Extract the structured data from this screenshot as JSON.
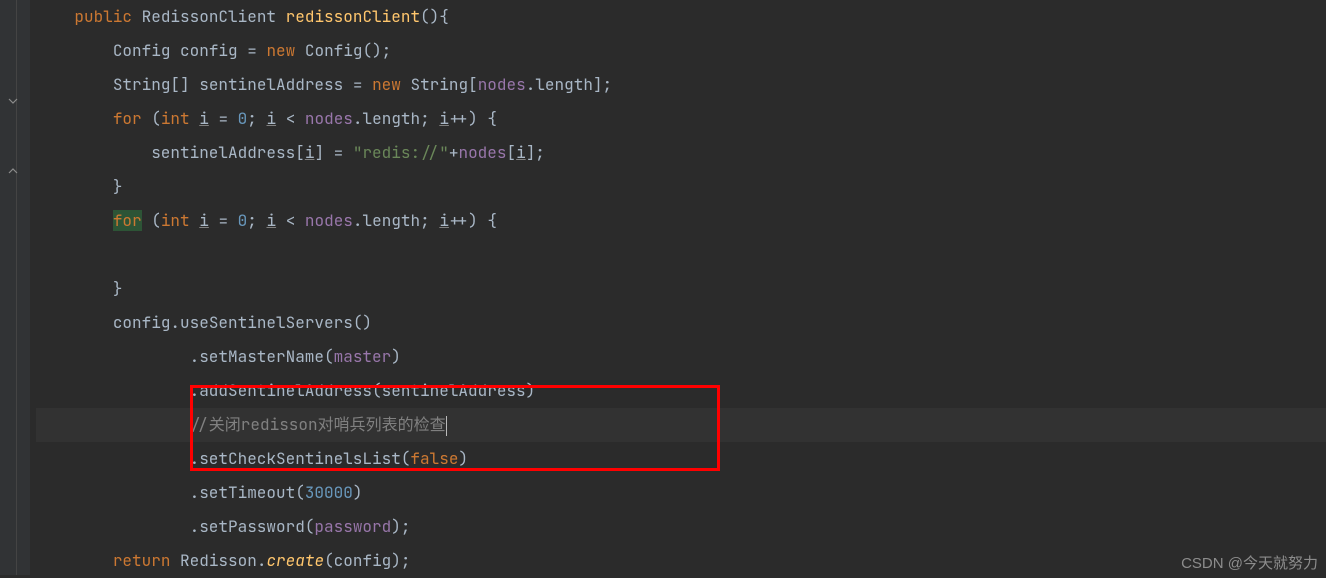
{
  "code": {
    "l1": {
      "kw": "public",
      "type": "RedissonClient",
      "method": "redissonClient",
      "after": "(){"
    },
    "l2": {
      "type": "Config",
      "var": "config",
      "eq": " = ",
      "new": "new",
      "cls": "Config",
      "end": "();"
    },
    "l3": {
      "type": "String[]",
      "var": "sentinelAddress",
      "eq": " = ",
      "new": "new",
      "cls": "String",
      "field": "nodes",
      "prop": ".length",
      "end": "];",
      "open": "["
    },
    "l4": {
      "kw": "for",
      "open": " (",
      "type": "int",
      "var": "i",
      "eq": " = ",
      "zero": "0",
      "sep": "; ",
      "var2": "i",
      "cmp": " < ",
      "field": "nodes",
      "prop": ".length",
      "sep2": "; ",
      "var3": "i",
      "inc": "++) {"
    },
    "l5": {
      "var": "sentinelAddress",
      "open": "[",
      "idx": "i",
      "close": "] = ",
      "str": "\"redis://\"",
      "plus": "+",
      "field": "nodes",
      "open2": "[",
      "idx2": "i",
      "end": "];"
    },
    "l6": {
      "close": "}"
    },
    "l7": {
      "kw": "for",
      "open": " (",
      "type": "int",
      "var": "i",
      "eq": " = ",
      "zero": "0",
      "sep": "; ",
      "var2": "i",
      "cmp": " < ",
      "field": "nodes",
      "prop": ".length",
      "sep2": "; ",
      "var3": "i",
      "inc": "++) {"
    },
    "l8": {
      "blank": ""
    },
    "l9": {
      "close": "}"
    },
    "l10": {
      "var": "config",
      "call": ".useSentinelServers()"
    },
    "l11": {
      "call": ".setMasterName(",
      "field": "master",
      "end": ")"
    },
    "l12": {
      "call": ".addSentinelAddress(",
      "arg": "sentinelAddress",
      "end": ")"
    },
    "l13": {
      "comment": "//关闭redisson对哨兵列表的检查"
    },
    "l14": {
      "call": ".setCheckSentinelsList(",
      "bool": "false",
      "end": ")"
    },
    "l15": {
      "call": ".setTimeout(",
      "num": "30000",
      "end": ")"
    },
    "l16": {
      "call": ".setPassword(",
      "field": "password",
      "end": ");"
    },
    "l17": {
      "kw": "return",
      "cls": "Redisson",
      "call": ".",
      "method": "create",
      "open": "(",
      "arg": "config",
      "end": ");"
    }
  },
  "watermark": "CSDN @今天就努力",
  "colors": {
    "bg": "#2b2b2b",
    "kw": "#cc7832",
    "str": "#6a8759",
    "num": "#6897bb",
    "field": "#9876aa",
    "method": "#ffc66d",
    "comment": "#808080",
    "ident": "#a9b7c6"
  }
}
